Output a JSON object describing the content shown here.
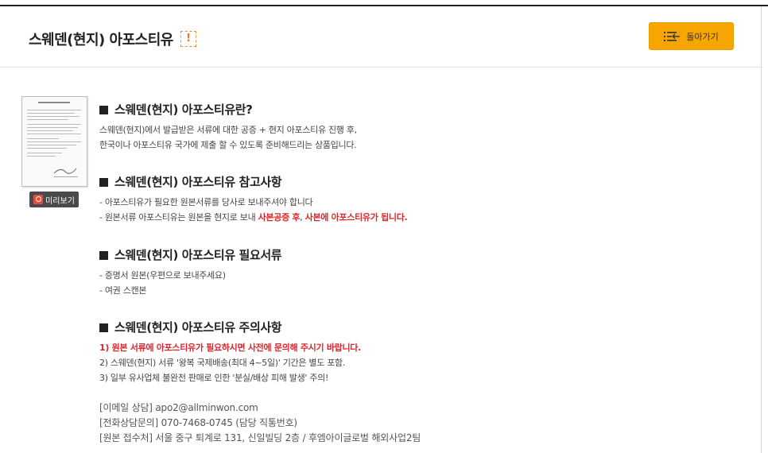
{
  "header": {
    "title": "스웨덴(현지) 아포스티유",
    "warning_icon_glyph": "!",
    "back_button_label": "돌아가기",
    "accent_color": "#f7a600"
  },
  "thumbnail": {
    "preview_label": "미리보기"
  },
  "sections": [
    {
      "title": "스웨덴(현지) 아포스티유란?",
      "lines": [
        "스웨덴(현지)에서 발급받은 서류에 대한 공증 + 현지 아포스티유 진행 후,",
        "한국이나 아포스티유 국가에 제출 할 수 있도록 준비해드리는 상품입니다."
      ]
    },
    {
      "title": "스웨덴(현지) 아포스티유 참고사항",
      "lines": [
        "- 아포스티유가 필요한 원본서류를 당사로 보내주셔야 합니다"
      ],
      "mixed_line": {
        "prefix": "- 원본서류 아포스티유는 원본을 현지로 보내 ",
        "highlight1": "사본공증 후",
        "middle": ", ",
        "highlight2": "사본에 아포스티유가 됩니다."
      }
    },
    {
      "title": "스웨덴(현지) 아포스티유 필요서류",
      "lines": [
        "- 증명서 원본(우편으로 보내주세요)",
        "- 여권 스캔본"
      ]
    },
    {
      "title": "스웨덴(현지) 아포스티유 주의사항",
      "red_line": "1) 원본 서류에 아포스티유가 필요하시면 사전에 문의해 주시기 바랍니다.",
      "lines": [
        "2) 스웨덴(현지) 서류 '왕복 국제배송(최대 4~5일)' 기간은 별도 포함.",
        "3) 일부 유사업체 불완전 판매로 인한 '분실/배상 피해 발생' 주의!"
      ]
    }
  ],
  "contact": {
    "email": "[이메일 상담] apo2@allminwon.com",
    "phone": "[전화상담문의] 070-7468-0745 (담당 직통번호)",
    "address": "[원본 접수처] 서울 중구 퇴계로 131, 신일빌딩 2층 / 후엠아이글로벌 해외사업2팀"
  }
}
